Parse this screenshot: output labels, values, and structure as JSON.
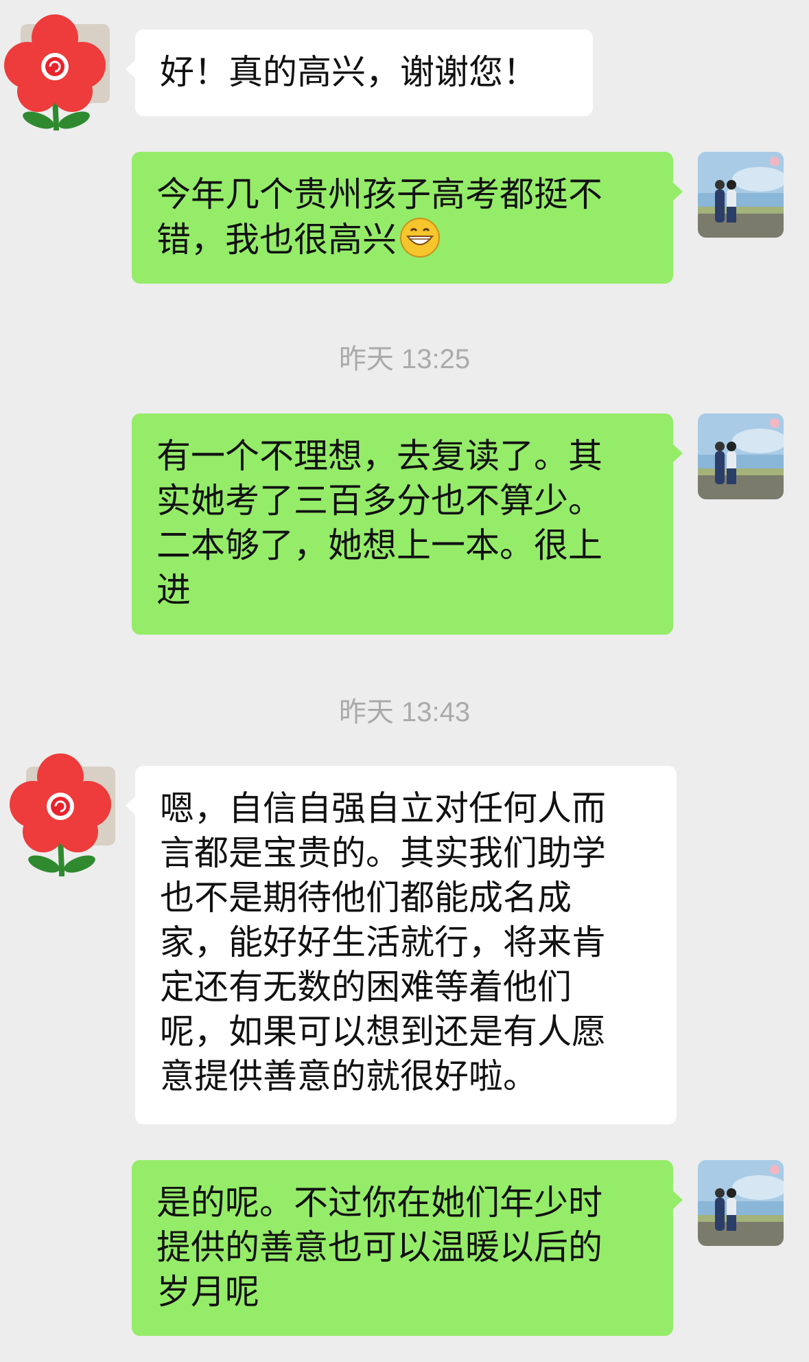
{
  "messages": [
    {
      "side": "left",
      "text": "好！真的高兴，谢谢您！"
    },
    {
      "side": "right",
      "text": "今年几个贵州孩子高考都挺不\n错，我也很高兴",
      "emoji": "grinning-face-emoji"
    },
    {
      "side": "right",
      "text": "有一个不理想，去复读了。其\n实她考了三百多分也不算少。\n二本够了，她想上一本。很上\n进"
    },
    {
      "side": "left",
      "text": "嗯，自信自强自立对任何人而\n言都是宝贵的。其实我们助学\n也不是期待他们都能成名成\n家，能好好生活就行，将来肯\n定还有无数的困难等着他们\n呢，如果可以想到还是有人愿\n意提供善意的就很好啦。"
    },
    {
      "side": "right",
      "text": "是的呢。不过你在她们年少时\n提供的善意也可以温暖以后的\n岁月呢"
    }
  ],
  "timestamps": [
    "昨天 13:25",
    "昨天 13:43"
  ],
  "avatars": {
    "contact": "red-flower-avatar",
    "self": "couple-photo-avatar"
  },
  "colors": {
    "background": "#ededed",
    "bubble_self": "#95ec69",
    "bubble_contact": "#ffffff",
    "timestamp_text": "#aaaaaa"
  }
}
